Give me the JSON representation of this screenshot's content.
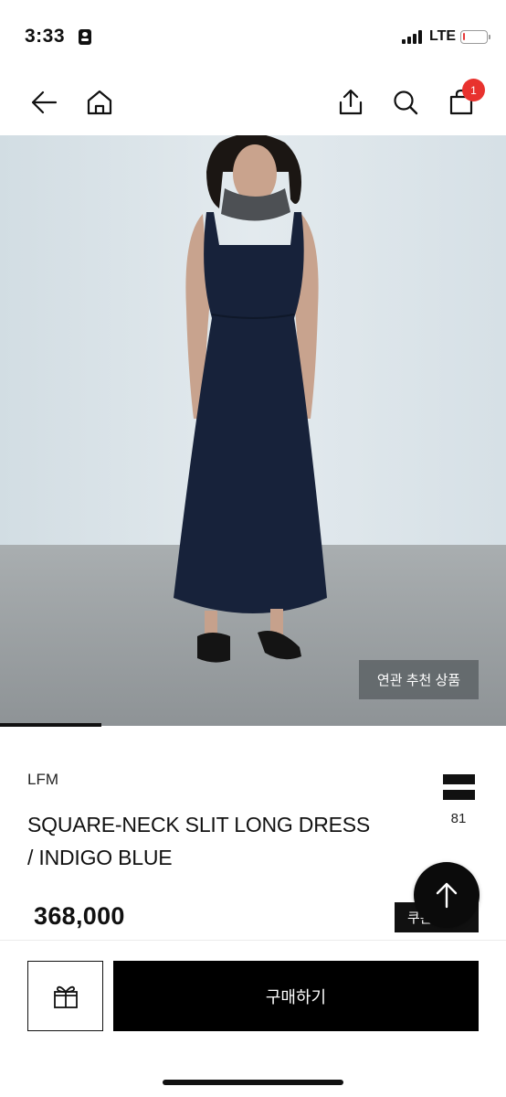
{
  "status_bar": {
    "time": "3:33",
    "network": "LTE",
    "battery_level": 0.1,
    "battery_color": "#e63b3b"
  },
  "nav": {
    "back_icon": "arrow-left-icon",
    "home_icon": "home-icon",
    "share_icon": "share-upload-icon",
    "search_icon": "search-icon",
    "cart_icon": "shopping-bag-icon",
    "cart_count": "1",
    "badge_color": "#e8322e"
  },
  "hero": {
    "related_button_label": "연관 추천 상품",
    "image_progress": 0.2
  },
  "product": {
    "brand": "LFM",
    "name_line1": "SQUARE-NECK SLIT LONG DRESS",
    "name_line2": "/ INDIGO BLUE",
    "price": "368,000",
    "like_icon": "bookmark-bars-icon",
    "like_count": "81",
    "coupon_label": "쿠폰"
  },
  "scroll_top": {
    "icon": "arrow-up-icon"
  },
  "bottom_bar": {
    "gift_icon": "gift-icon",
    "buy_label": "구매하기"
  }
}
